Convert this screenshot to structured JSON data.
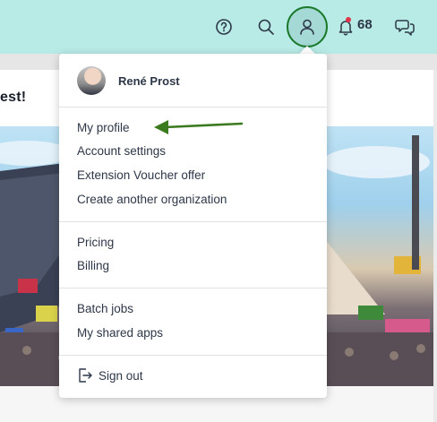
{
  "header": {
    "notification_count": "68",
    "icons": [
      "help-icon",
      "search-icon",
      "user-icon",
      "bell-icon",
      "chat-icon"
    ]
  },
  "card": {
    "title_fragment": "est!"
  },
  "menu": {
    "user_name": "René Prost",
    "groups": [
      [
        "My profile",
        "Account settings",
        "Extension Voucher offer",
        "Create another organization"
      ],
      [
        "Pricing",
        "Billing"
      ],
      [
        "Batch jobs",
        "My shared apps"
      ]
    ],
    "sign_out": "Sign out"
  },
  "colors": {
    "topbar": "#b9ebe6",
    "avatar_ring": "#1a7a2a",
    "arrow": "#3b7a1e",
    "notification_dot": "#e2344a"
  }
}
